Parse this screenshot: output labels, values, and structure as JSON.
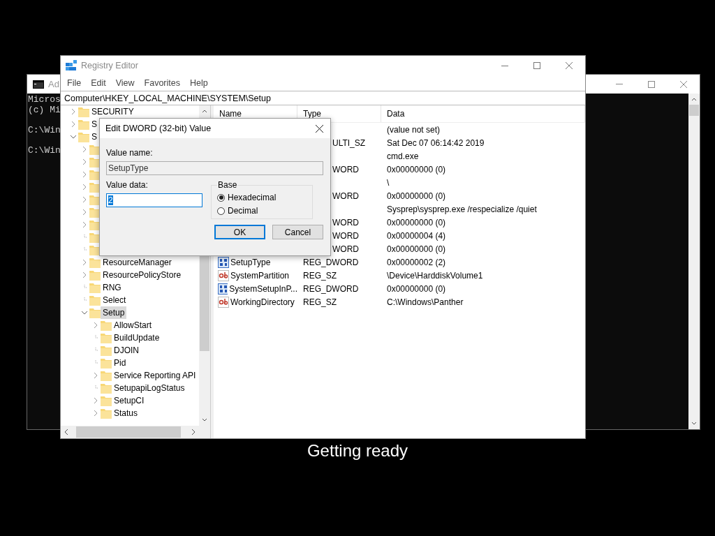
{
  "console": {
    "title": "Ad",
    "blocks": [
      [
        "Micros",
        "(c) Mi"
      ],
      [
        "C:\\Win"
      ],
      [
        "C:\\Win"
      ]
    ]
  },
  "regedit": {
    "title": "Registry Editor",
    "menu": [
      "File",
      "Edit",
      "View",
      "Favorites",
      "Help"
    ],
    "address": "Computer\\HKEY_LOCAL_MACHINE\\SYSTEM\\Setup",
    "tree": [
      {
        "label": "SECURITY",
        "expandable": true,
        "expanded": false,
        "selected": false
      },
      {
        "label": "S",
        "expandable": true,
        "expanded": false,
        "selected": false
      },
      {
        "label": "S",
        "expandable": true,
        "expanded": true,
        "selected": false,
        "children": [
          {
            "expandable": true,
            "expanded": false
          },
          {
            "expandable": true,
            "expanded": false
          },
          {
            "expandable": true,
            "expanded": false
          },
          {
            "expandable": true,
            "expanded": false
          },
          {
            "expandable": true,
            "expanded": false
          },
          {
            "expandable": true,
            "expanded": false
          },
          {
            "expandable": true,
            "expanded": false
          },
          {
            "expandable": false,
            "expanded": false
          },
          {
            "expandable": false,
            "expanded": false
          },
          {
            "label": "ResourceManager",
            "expandable": true,
            "expanded": false,
            "selected": false
          },
          {
            "label": "ResourcePolicyStore",
            "expandable": true,
            "expanded": false,
            "selected": false
          },
          {
            "label": "RNG",
            "expandable": false,
            "expanded": false,
            "selected": false
          },
          {
            "label": "Select",
            "expandable": false,
            "expanded": false,
            "selected": false
          },
          {
            "label": "Setup",
            "expandable": true,
            "expanded": true,
            "selected": true,
            "children": [
              {
                "label": "AllowStart",
                "expandable": true,
                "expanded": false,
                "selected": false
              },
              {
                "label": "BuildUpdate",
                "expandable": false,
                "expanded": false,
                "selected": false
              },
              {
                "label": "DJOIN",
                "expandable": false,
                "expanded": false,
                "selected": false
              },
              {
                "label": "Pid",
                "expandable": false,
                "expanded": false,
                "selected": false
              },
              {
                "label": "Service Reporting API",
                "expandable": true,
                "expanded": false,
                "selected": false
              },
              {
                "label": "SetupapiLogStatus",
                "expandable": false,
                "expanded": false,
                "selected": false
              },
              {
                "label": "SetupCI",
                "expandable": true,
                "expanded": false,
                "selected": false
              },
              {
                "label": "Status",
                "expandable": true,
                "expanded": false,
                "selected": false
              }
            ]
          }
        ]
      }
    ],
    "columns": [
      "Name",
      "Type",
      "Data"
    ],
    "rows": [
      {
        "type_tail": "",
        "data": "(value not set)"
      },
      {
        "type_tail": "ULTI_SZ",
        "data": "Sat Dec 07 06:14:42 2019"
      },
      {
        "type_tail": "",
        "data": "cmd.exe"
      },
      {
        "type_tail": "WORD",
        "data": "0x00000000 (0)"
      },
      {
        "type_tail": "",
        "data": "\\"
      },
      {
        "type_tail": "WORD",
        "data": "0x00000000 (0)"
      },
      {
        "type_tail": "",
        "data": "Sysprep\\sysprep.exe /respecialize /quiet"
      },
      {
        "type_tail": "WORD",
        "data": "0x00000000 (0)"
      },
      {
        "type_tail": "WORD",
        "data": "0x00000004 (4)"
      },
      {
        "type_tail": "WORD",
        "data": "0x00000000 (0)"
      },
      {
        "kind": "dword",
        "name": "SetupType",
        "type": "REG_DWORD",
        "data": "0x00000002 (2)"
      },
      {
        "kind": "string",
        "name": "SystemPartition",
        "type": "REG_SZ",
        "data": "\\Device\\HarddiskVolume1"
      },
      {
        "kind": "dword",
        "name": "SystemSetupInP...",
        "type": "REG_DWORD",
        "data": "0x00000000 (0)"
      },
      {
        "kind": "string",
        "name": "WorkingDirectory",
        "type": "REG_SZ",
        "data": "C:\\Windows\\Panther"
      }
    ]
  },
  "dialog": {
    "title": "Edit DWORD (32-bit) Value",
    "name_label": "Value name:",
    "name_value": "SetupType",
    "data_label": "Value data:",
    "data_value": "2",
    "base_label": "Base",
    "bases": [
      {
        "label": "Hexadecimal",
        "selected": true
      },
      {
        "label": "Decimal",
        "selected": false
      }
    ],
    "buttons": [
      {
        "label": "OK",
        "default": true
      },
      {
        "label": "Cancel",
        "default": false
      }
    ]
  },
  "caption": "Getting ready"
}
